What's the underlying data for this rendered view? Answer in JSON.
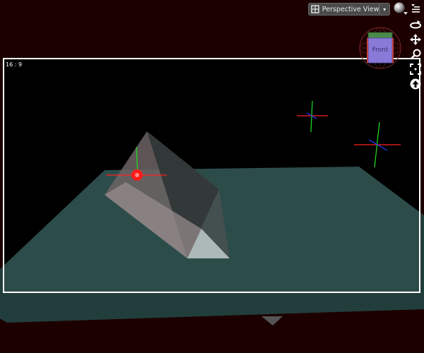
{
  "view_menu": {
    "label": "Perspective View",
    "caret": "▾"
  },
  "navcube": {
    "face_label": "Front"
  },
  "frame": {
    "aspect_label": "16 : 9"
  },
  "colors": {
    "background": "#1c0000",
    "frame_fill": "#000000",
    "ground_plane": "#2a4a48",
    "frame_border": "#ffffff",
    "axis_x": "#ff2020",
    "axis_y": "#20e020",
    "axis_z": "#2040ff",
    "selection": "#ff1a1a",
    "navcube_face": "#8a7ad8"
  },
  "toolbar": {
    "shading_icon": "shading-ball-icon",
    "panel_menu_icon": "panel-menu-icon",
    "orbit_icon": "orbit-icon",
    "pan_icon": "pan-icon",
    "zoom_icon": "zoom-icon",
    "frame_icon": "frame-selection-icon",
    "up_icon": "up-arrow-icon"
  }
}
